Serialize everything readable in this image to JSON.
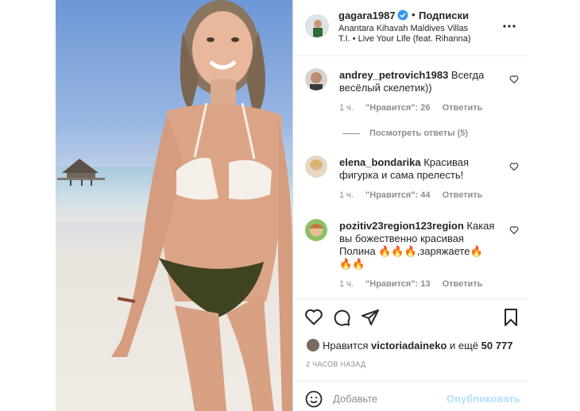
{
  "post": {
    "username": "gagara1987",
    "follow_label": "Подписки",
    "location": "Anantara Kihavah Maldives Villas",
    "music": "T.I. • Live Your Life (feat. Rihanna)",
    "more_icon": "more-horizontal-icon"
  },
  "comments": [
    {
      "user": "andrey_petrovich1983",
      "text": "Всегда весёлый скелетик))",
      "time": "1 ч.",
      "likes": "\"Нравится\": 26",
      "reply": "Ответить",
      "view_replies": "Посмотреть ответы (5)"
    },
    {
      "user": "elena_bondarika",
      "text": "Красивая фигурка и сама прелесть!",
      "time": "1 ч.",
      "likes": "\"Нравится\": 44",
      "reply": "Ответить"
    },
    {
      "user": "pozitiv23region123region",
      "text_a": "Какая вы божественно красивая Полина",
      "fire_a": "🔥🔥🔥",
      "text_b": ",заряжаете",
      "fire_b": "🔥",
      "fire_c": "🔥🔥",
      "time": "1 ч.",
      "likes": "\"Нравится\": 13",
      "reply": "Ответить"
    }
  ],
  "actions": {
    "like_icon": "heart-icon",
    "comment_icon": "comment-icon",
    "share_icon": "share-icon",
    "save_icon": "bookmark-icon"
  },
  "likes_line": {
    "prefix": "Нравится",
    "user": "victoriadaineko",
    "middle": "и ещё",
    "count": "50 777"
  },
  "time_ago": "2 ЧАСОВ НАЗАД",
  "add_comment": {
    "placeholder": "Добавьте",
    "publish_label": "Опубликовать"
  },
  "colors": {
    "accent": "#0095f6",
    "publish_disabled": "#b2dffc",
    "text": "#262626",
    "muted": "#8e8e8e",
    "verified": "#3897f0",
    "fire": "#ff6a00"
  }
}
